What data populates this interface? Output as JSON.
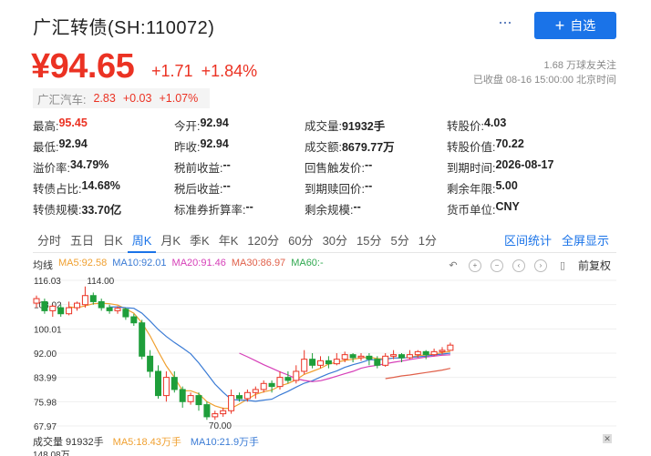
{
  "header": {
    "title": "广汇转债(SH:110072)",
    "more_label": "···",
    "add_button_label": "自选",
    "add_button_icon": "+"
  },
  "quote": {
    "price": "¥94.65",
    "change": "+1.71",
    "change_pct": "+1.84%",
    "followers": "1.68 万球友关注",
    "status": "已收盘 08-16 15:00:00 北京时间",
    "color_up": "#eb3223"
  },
  "underlying": {
    "name": "广汇汽车:",
    "price": "2.83",
    "change": "+0.03",
    "change_pct": "+1.07%"
  },
  "stats": [
    [
      {
        "label": "最高:",
        "value": "95.45",
        "red": true
      },
      {
        "label": "今开:",
        "value": "92.94"
      },
      {
        "label": "成交量:",
        "value": "91932手"
      },
      {
        "label": "转股价:",
        "value": "4.03"
      }
    ],
    [
      {
        "label": "最低:",
        "value": "92.94"
      },
      {
        "label": "昨收:",
        "value": "92.94"
      },
      {
        "label": "成交额:",
        "value": "8679.77万"
      },
      {
        "label": "转股价值:",
        "value": "70.22"
      }
    ],
    [
      {
        "label": "溢价率:",
        "value": "34.79%"
      },
      {
        "label": "税前收益:",
        "value": "--"
      },
      {
        "label": "回售触发价:",
        "value": "--"
      },
      {
        "label": "到期时间:",
        "value": "2026-08-17"
      }
    ],
    [
      {
        "label": "转债占比:",
        "value": "14.68%"
      },
      {
        "label": "税后收益:",
        "value": "--"
      },
      {
        "label": "到期赎回价:",
        "value": "--"
      },
      {
        "label": "剩余年限:",
        "value": "5.00"
      }
    ],
    [
      {
        "label": "转债规模:",
        "value": "33.70亿"
      },
      {
        "label": "标准券折算率:",
        "value": "--"
      },
      {
        "label": "剩余规模:",
        "value": "--"
      },
      {
        "label": "货币单位:",
        "value": "CNY"
      }
    ]
  ],
  "tabs": [
    "分时",
    "五日",
    "日K",
    "周K",
    "月K",
    "季K",
    "年K",
    "120分",
    "60分",
    "30分",
    "15分",
    "5分",
    "1分"
  ],
  "active_tab": "周K",
  "tab_links": {
    "interval_stats": "区间统计",
    "fullscreen": "全屏显示"
  },
  "ma_legend": {
    "label": "均线",
    "ma5": "MA5:92.58",
    "ma10": "MA10:92.01",
    "ma20": "MA20:91.46",
    "ma30": "MA30:86.97",
    "ma60": "MA60:-"
  },
  "toolbar": {
    "adjust_label": "前复权"
  },
  "volume": {
    "label": "成交量 91932手",
    "ma5": "MA5:18.43万手",
    "ma10": "MA10:21.9万手",
    "axis_max": "148.08万"
  },
  "colors": {
    "up": "#eb3223",
    "down": "#1e9e3a",
    "ma5": "#f0a030",
    "ma10": "#3a7bd5",
    "ma20": "#d63fb8",
    "ma30": "#e0604a",
    "accent": "#1a73e8"
  },
  "chart_data": {
    "type": "candlestick",
    "y_ticks": [
      "116.03",
      "108.02",
      "100.01",
      "92.00",
      "83.99",
      "75.98",
      "67.97"
    ],
    "ylim": [
      67.97,
      116.03
    ],
    "annotations": [
      {
        "text": "114.00"
      },
      {
        "text": "70.00"
      }
    ],
    "candles": [
      {
        "o": 108.5,
        "c": 110,
        "h": 111,
        "l": 107
      },
      {
        "o": 109,
        "c": 106,
        "h": 110,
        "l": 105
      },
      {
        "o": 106,
        "c": 107.5,
        "h": 108,
        "l": 104
      },
      {
        "o": 107,
        "c": 105,
        "h": 108,
        "l": 104
      },
      {
        "o": 105,
        "c": 107,
        "h": 109,
        "l": 104.5
      },
      {
        "o": 107,
        "c": 108.5,
        "h": 109,
        "l": 106
      },
      {
        "o": 108,
        "c": 111,
        "h": 114,
        "l": 107
      },
      {
        "o": 111,
        "c": 109,
        "h": 112,
        "l": 108
      },
      {
        "o": 109,
        "c": 107,
        "h": 110,
        "l": 106
      },
      {
        "o": 107,
        "c": 106,
        "h": 108,
        "l": 105
      },
      {
        "o": 106,
        "c": 106.8,
        "h": 107.5,
        "l": 105
      },
      {
        "o": 106.5,
        "c": 104,
        "h": 107,
        "l": 103
      },
      {
        "o": 104,
        "c": 102,
        "h": 105,
        "l": 101
      },
      {
        "o": 102,
        "c": 91,
        "h": 103,
        "l": 90
      },
      {
        "o": 91,
        "c": 86,
        "h": 93,
        "l": 84
      },
      {
        "o": 86,
        "c": 78,
        "h": 88,
        "l": 77
      },
      {
        "o": 78,
        "c": 84,
        "h": 86,
        "l": 76
      },
      {
        "o": 84,
        "c": 80,
        "h": 86,
        "l": 79
      },
      {
        "o": 80,
        "c": 76,
        "h": 81,
        "l": 74
      },
      {
        "o": 76,
        "c": 78,
        "h": 79,
        "l": 75
      },
      {
        "o": 78,
        "c": 75,
        "h": 79,
        "l": 73
      },
      {
        "o": 75,
        "c": 71,
        "h": 76,
        "l": 70
      },
      {
        "o": 71,
        "c": 72,
        "h": 73,
        "l": 70
      },
      {
        "o": 72,
        "c": 73,
        "h": 74,
        "l": 71
      },
      {
        "o": 73,
        "c": 78,
        "h": 80,
        "l": 72
      },
      {
        "o": 78,
        "c": 77,
        "h": 79,
        "l": 76
      },
      {
        "o": 77,
        "c": 79,
        "h": 80,
        "l": 76
      },
      {
        "o": 79,
        "c": 80,
        "h": 81,
        "l": 77
      },
      {
        "o": 80,
        "c": 82,
        "h": 83,
        "l": 79
      },
      {
        "o": 82,
        "c": 81,
        "h": 83,
        "l": 79
      },
      {
        "o": 81,
        "c": 84,
        "h": 86,
        "l": 80
      },
      {
        "o": 84,
        "c": 83,
        "h": 86,
        "l": 82
      },
      {
        "o": 83,
        "c": 86,
        "h": 88,
        "l": 82
      },
      {
        "o": 86,
        "c": 90,
        "h": 93,
        "l": 85
      },
      {
        "o": 90,
        "c": 88,
        "h": 92,
        "l": 87
      },
      {
        "o": 88,
        "c": 89.5,
        "h": 91,
        "l": 87
      },
      {
        "o": 89.5,
        "c": 88.5,
        "h": 91,
        "l": 87
      },
      {
        "o": 88.5,
        "c": 90,
        "h": 92,
        "l": 88
      },
      {
        "o": 90,
        "c": 91.5,
        "h": 92.5,
        "l": 89
      },
      {
        "o": 91.5,
        "c": 90.5,
        "h": 92,
        "l": 89
      },
      {
        "o": 90.5,
        "c": 91,
        "h": 92,
        "l": 89.5
      },
      {
        "o": 91,
        "c": 90,
        "h": 92,
        "l": 88
      },
      {
        "o": 90,
        "c": 88,
        "h": 91,
        "l": 87
      },
      {
        "o": 88,
        "c": 91,
        "h": 92,
        "l": 87.5
      },
      {
        "o": 91,
        "c": 91.5,
        "h": 93,
        "l": 90
      },
      {
        "o": 91.5,
        "c": 90.5,
        "h": 92,
        "l": 89
      },
      {
        "o": 90.5,
        "c": 91.5,
        "h": 93,
        "l": 90
      },
      {
        "o": 91.5,
        "c": 92.5,
        "h": 93,
        "l": 90.5
      },
      {
        "o": 92.5,
        "c": 91.5,
        "h": 93,
        "l": 90
      },
      {
        "o": 91.5,
        "c": 92.5,
        "h": 93.5,
        "l": 91
      },
      {
        "o": 92.5,
        "c": 92.94,
        "h": 94,
        "l": 91.5
      },
      {
        "o": 92.94,
        "c": 94.65,
        "h": 95.45,
        "l": 92.94
      }
    ],
    "ma5": [
      null,
      null,
      null,
      null,
      107.3,
      107,
      107.6,
      108.3,
      108.5,
      108.3,
      107.9,
      106.6,
      105.2,
      102,
      97.7,
      92.6,
      87.8,
      84,
      79.6,
      79.6,
      78.6,
      76,
      74.6,
      73.8,
      73.8,
      75.2,
      76.8,
      78.4,
      79.2,
      79.8,
      81.2,
      82,
      83.2,
      85,
      86,
      87,
      88.4,
      89,
      89.6,
      90,
      90.4,
      90.7,
      90.2,
      90.1,
      90.4,
      90.4,
      90.6,
      91.2,
      91.4,
      91.7,
      92.2,
      92.58
    ],
    "ma10": [
      null,
      null,
      null,
      null,
      null,
      null,
      null,
      null,
      null,
      107.2,
      107.3,
      107,
      106.8,
      105.2,
      102.6,
      99.8,
      97.5,
      95.5,
      93.7,
      91.8,
      88.8,
      85.3,
      81.8,
      79.1,
      76.7,
      76.5,
      76.4,
      76.1,
      76.5,
      76.8,
      78.2,
      79.4,
      80.8,
      82.1,
      82.9,
      84.1,
      85.2,
      86.1,
      87.3,
      88.2,
      88.9,
      89.8,
      89.8,
      90,
      90.4,
      90.4,
      90.6,
      90.8,
      91,
      91.4,
      91.7,
      92.01
    ],
    "ma20": [
      null,
      null,
      null,
      null,
      null,
      null,
      null,
      null,
      null,
      null,
      null,
      null,
      null,
      null,
      null,
      null,
      null,
      null,
      null,
      null,
      null,
      null,
      null,
      null,
      null,
      92,
      90.8,
      89.5,
      88.2,
      87,
      85.8,
      84.8,
      83.6,
      83,
      82.6,
      82.9,
      83.6,
      84.4,
      85.2,
      86,
      87,
      87.6,
      88,
      88.5,
      89,
      89.4,
      89.9,
      90.3,
      90.7,
      91,
      91.3,
      91.46
    ],
    "ma30": [
      null,
      null,
      null,
      null,
      null,
      null,
      null,
      null,
      null,
      null,
      null,
      null,
      null,
      null,
      null,
      null,
      null,
      null,
      null,
      null,
      null,
      null,
      null,
      null,
      null,
      null,
      null,
      null,
      null,
      null,
      null,
      null,
      null,
      null,
      null,
      null,
      null,
      null,
      null,
      null,
      null,
      null,
      null,
      83.6,
      84,
      84.5,
      84.8,
      85.2,
      85.6,
      86,
      86.4,
      86.97
    ]
  }
}
